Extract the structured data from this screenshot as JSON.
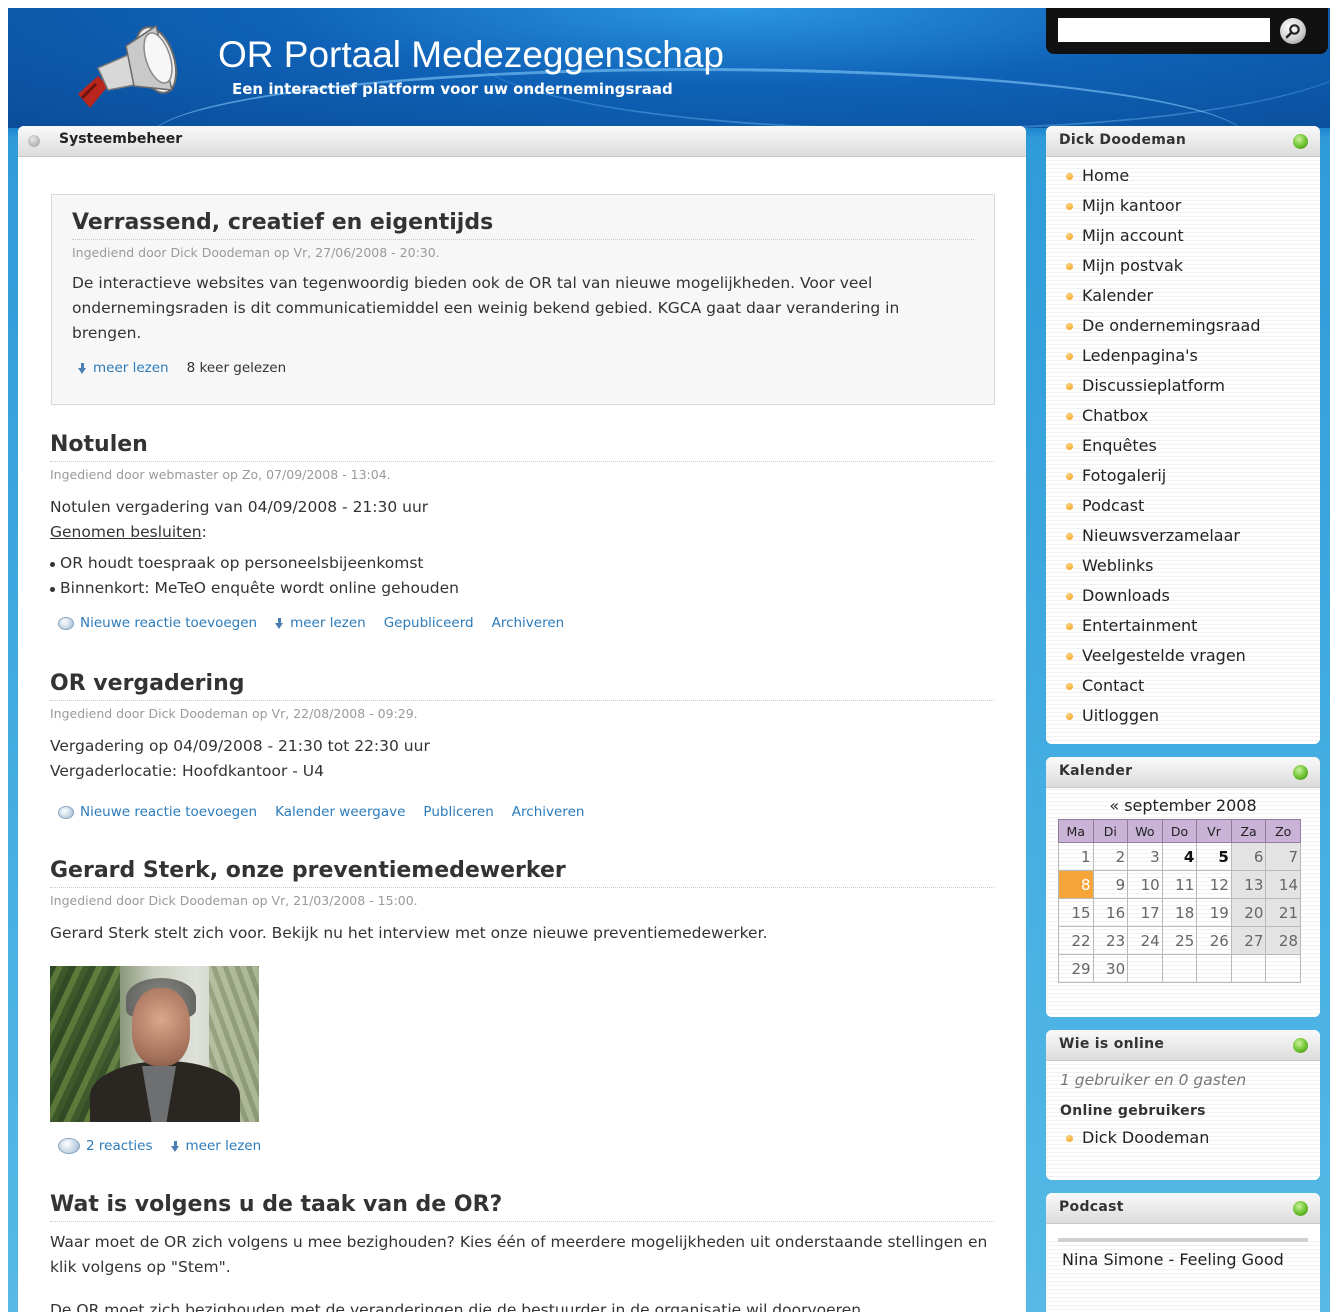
{
  "header": {
    "site_title": "OR Portaal Medezeggenschap",
    "slogan": "Een interactief platform voor uw ondernemingsraad",
    "search": {
      "value": "",
      "button_icon": "search-icon"
    }
  },
  "main": {
    "section_title": "Systeembeheer",
    "nodes": [
      {
        "title": "Verrassend, creatief en eigentijds",
        "meta": "Ingediend door Dick Doodeman op Vr, 27/06/2008 - 20:30.",
        "body": "De interactieve websites van tegenwoordig bieden ook de OR tal van nieuwe mogelijkheden. Voor veel ondernemingsraden is dit communicatiemiddel een weinig bekend gebied. KGCA gaat daar verandering in brengen.",
        "read_more": "meer lezen",
        "reads": "8 keer gelezen"
      },
      {
        "title": "Notulen",
        "meta": "Ingediend door webmaster op Zo, 07/09/2008 - 13:04.",
        "body_line": "Notulen vergadering van 04/09/2008 - 21:30 uur",
        "decisions_label": "Genomen besluiten",
        "decisions_suffix": ":",
        "bullets": [
          "OR houdt toespraak op personeelsbijeenkomst",
          "Binnenkort: MeTeO enquête wordt online gehouden"
        ],
        "link_comment": "Nieuwe reactie toevoegen",
        "link_more": "meer lezen",
        "link_published": "Gepubliceerd",
        "link_archive": "Archiveren"
      },
      {
        "title": "OR vergadering",
        "meta": "Ingediend door Dick Doodeman op Vr, 22/08/2008 - 09:29.",
        "line1": "Vergadering op 04/09/2008 - 21:30 tot 22:30 uur",
        "line2": "Vergaderlocatie: Hoofdkantoor - U4",
        "link_comment": "Nieuwe reactie toevoegen",
        "link_calendar": "Kalender weergave",
        "link_publish": "Publiceren",
        "link_archive": "Archiveren"
      },
      {
        "title": "Gerard Sterk, onze preventiemedewerker",
        "meta": "Ingediend door Dick Doodeman op Vr, 21/03/2008 - 15:00.",
        "body": "Gerard Sterk stelt zich voor. Bekijk nu het interview met onze nieuwe preventiemedewerker.",
        "link_comments": "2 reacties",
        "link_more": "meer lezen"
      },
      {
        "title": "Wat is volgens u de taak van de OR?",
        "body": "Waar moet de OR zich volgens u mee bezighouden? Kies één of meerdere mogelijkheden uit onderstaande stellingen en klik volgens op \"Stem\".",
        "body2": "De OR moet zich bezighouden met de veranderingen die de bestuurder in de organisatie wil doorvoeren."
      }
    ]
  },
  "sidebar": {
    "user_block": {
      "title": "Dick Doodeman",
      "items": [
        "Home",
        "Mijn kantoor",
        "Mijn account",
        "Mijn postvak",
        "Kalender",
        "De ondernemingsraad",
        "Ledenpagina's",
        "Discussieplatform",
        "Chatbox",
        "Enquêtes",
        "Fotogalerij",
        "Podcast",
        "Nieuwsverzamelaar",
        "Weblinks",
        "Downloads",
        "Entertainment",
        "Veelgestelde vragen",
        "Contact",
        "Uitloggen"
      ]
    },
    "calendar": {
      "title": "Kalender",
      "caption": "« september 2008",
      "weekdays": [
        "Ma",
        "Di",
        "Wo",
        "Do",
        "Vr",
        "Za",
        "Zo"
      ],
      "weeks": [
        [
          "1",
          "2",
          "3",
          "4",
          "5",
          "6",
          "7"
        ],
        [
          "8",
          "9",
          "10",
          "11",
          "12",
          "13",
          "14"
        ],
        [
          "15",
          "16",
          "17",
          "18",
          "19",
          "20",
          "21"
        ],
        [
          "22",
          "23",
          "24",
          "25",
          "26",
          "27",
          "28"
        ],
        [
          "29",
          "30",
          "",
          "",
          "",
          "",
          ""
        ]
      ],
      "today": "8",
      "bold_days": [
        "4",
        "5"
      ]
    },
    "online": {
      "title": "Wie is online",
      "summary": "1 gebruiker en 0 gasten",
      "subtitle": "Online gebruikers",
      "users": [
        "Dick Doodeman"
      ]
    },
    "podcast": {
      "title": "Podcast",
      "track": "Nina Simone - Feeling Good"
    }
  }
}
